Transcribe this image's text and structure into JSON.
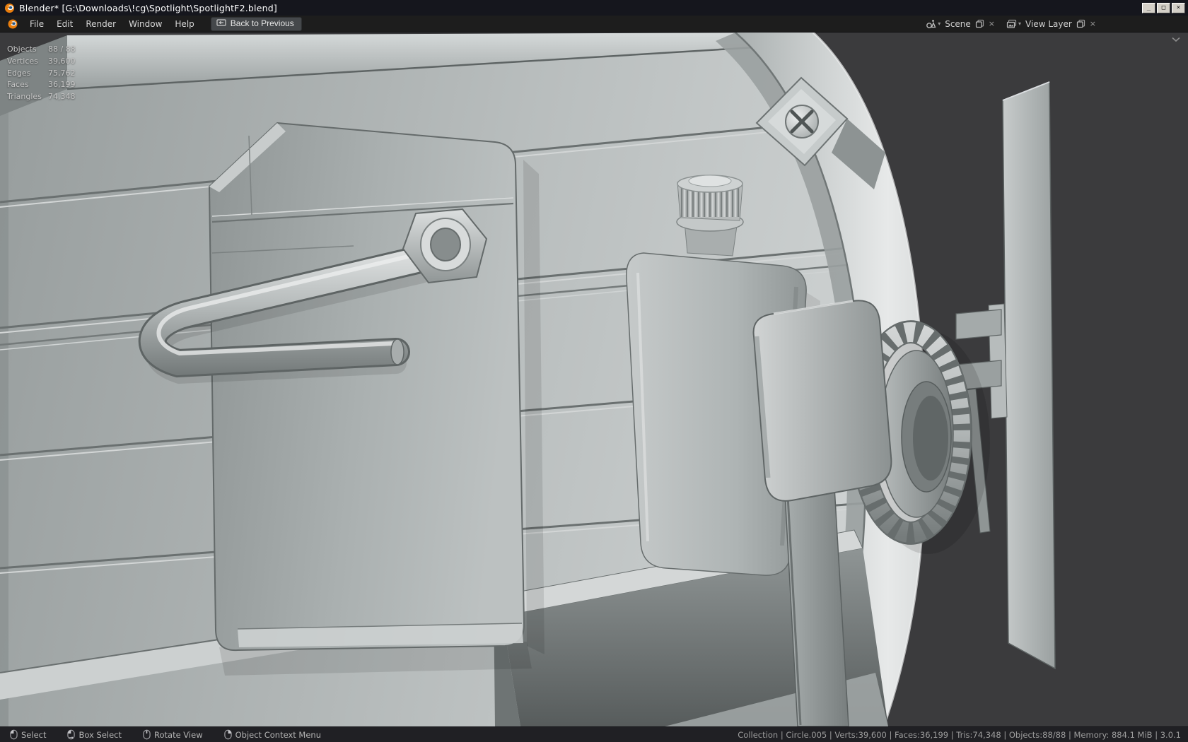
{
  "window": {
    "title": "Blender* [G:\\Downloads\\!cg\\Spotlight\\SpotlightF2.blend]",
    "controls": {
      "minimize": "_",
      "maximize": "□",
      "close": "×"
    }
  },
  "menubar": {
    "menus": [
      "File",
      "Edit",
      "Render",
      "Window",
      "Help"
    ],
    "back_button": "Back to Previous",
    "scene_selector": {
      "value": "Scene"
    },
    "view_layer_selector": {
      "value": "View Layer"
    }
  },
  "viewport": {
    "stats": [
      {
        "label": "Objects",
        "value": "88 / 88"
      },
      {
        "label": "Vertices",
        "value": "39,600"
      },
      {
        "label": "Edges",
        "value": "75,762"
      },
      {
        "label": "Faces",
        "value": "36,199"
      },
      {
        "label": "Triangles",
        "value": "74,348"
      }
    ]
  },
  "statusbar": {
    "hints": [
      {
        "icon": "mouse-left-icon",
        "label": "Select"
      },
      {
        "icon": "mouse-drag-icon",
        "label": "Box Select"
      },
      {
        "icon": "mouse-middle-icon",
        "label": "Rotate View"
      },
      {
        "icon": "mouse-right-icon",
        "label": "Object Context Menu"
      }
    ],
    "info": "Collection | Circle.005 | Verts:39,600 | Faces:36,199 | Tris:74,348 | Objects:88/88 | Memory: 884.1 MiB | 3.0.1"
  },
  "icons": {
    "caret": "▾",
    "close": "×"
  },
  "colors": {
    "accent_orange": "#e87d0d",
    "titlebar_bg": "#15161d",
    "menubar_bg": "#1d1d1d",
    "statusbar_bg": "#202024",
    "viewport_bg": "#3b3b3d"
  }
}
